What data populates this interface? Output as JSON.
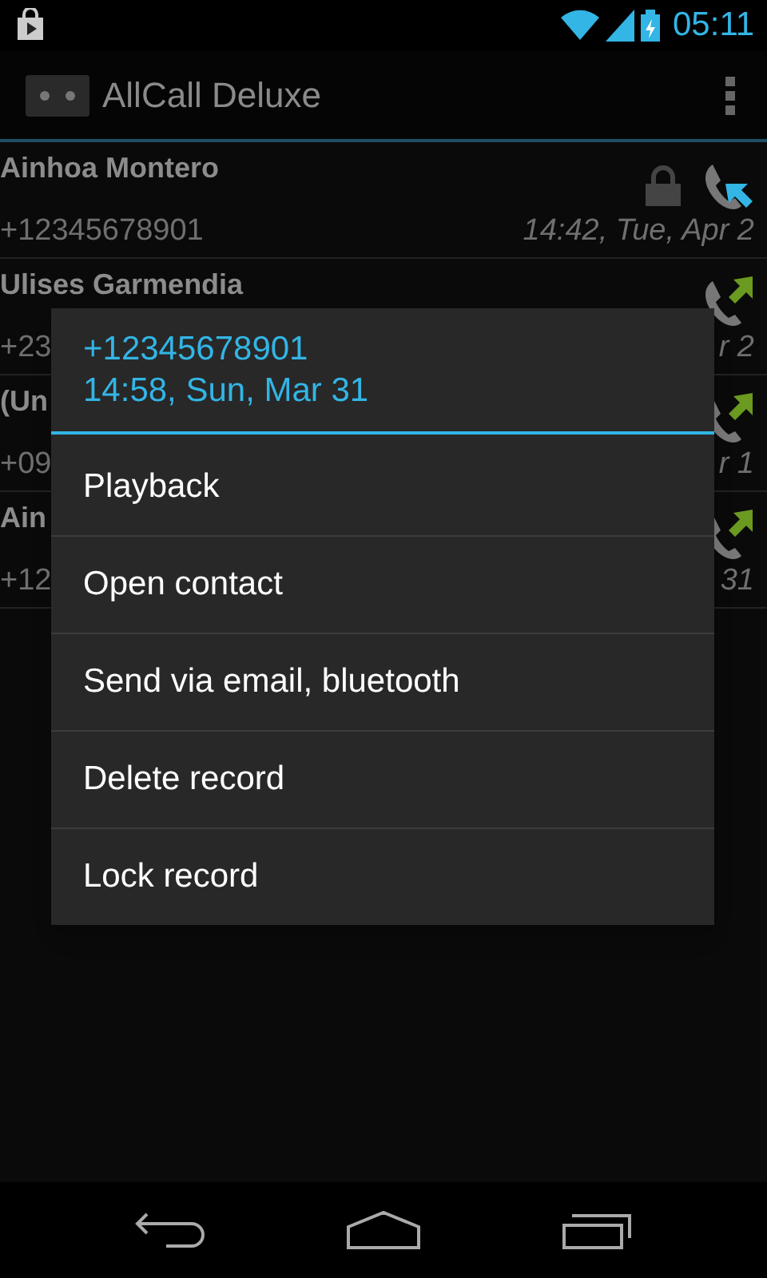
{
  "status_bar": {
    "time": "05:11"
  },
  "action_bar": {
    "title": "AllCall Deluxe"
  },
  "calls": [
    {
      "name": "Ainhoa Montero",
      "number": "+12345678901",
      "time": "14:42, Tue, Apr 2",
      "locked": true,
      "kind": "incoming"
    },
    {
      "name": "Ulises Garmendia",
      "number": "+23",
      "time": "r 2",
      "locked": false,
      "kind": "outgoing"
    },
    {
      "name": "(Un",
      "number": "+09",
      "time": "r 1",
      "locked": false,
      "kind": "outgoing"
    },
    {
      "name": "Ain",
      "number": "+12",
      "time": "31",
      "locked": false,
      "kind": "outgoing"
    }
  ],
  "context_menu": {
    "title": "+12345678901",
    "subtitle": "14:58, Sun, Mar 31",
    "items": [
      "Playback",
      "Open contact",
      "Send via email, bluetooth",
      "Delete record",
      "Lock record"
    ]
  }
}
